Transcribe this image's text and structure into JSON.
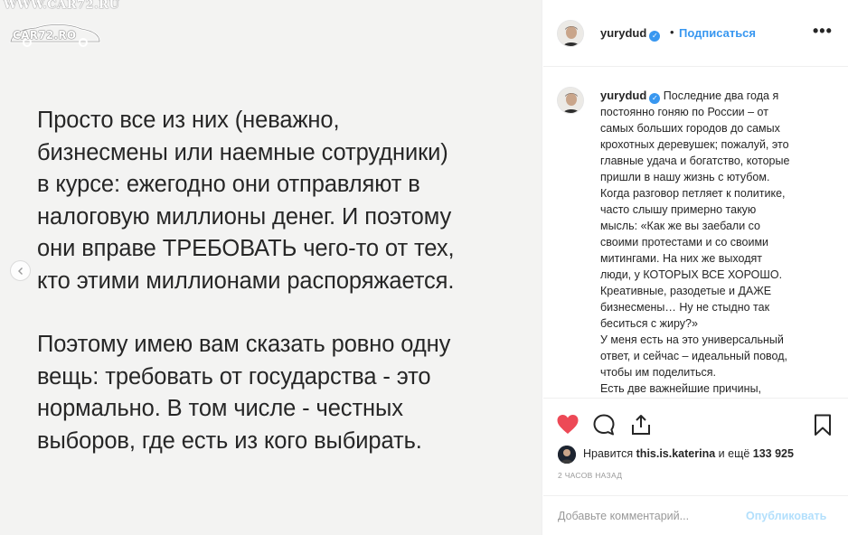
{
  "watermark": {
    "site_top": "WWW.CAR72.RU",
    "logo_text": "CAR72.RO"
  },
  "image_text": {
    "paragraph1": [
      "Просто все из них (неважно,",
      "бизнесмены или наемные сотрудники)",
      "в курсе: ежегодно они отправляют в",
      "налоговую миллионы денег. И поэтому",
      "они вправе ТРЕБОВАТЬ чего-то от тех,",
      "кто этими миллионами распоряжается."
    ],
    "paragraph2": [
      "Поэтому имею вам сказать ровно одну",
      "вещь: требовать от государства - это",
      "нормально. В том числе - честных",
      "выборов, где есть из кого выбирать."
    ]
  },
  "header": {
    "username": "yurydud",
    "separator": "•",
    "follow_label": "Подписаться",
    "more_icon": "more-options-icon",
    "more_glyph": "•••"
  },
  "caption": {
    "username": "yurydud",
    "lines": [
      "Последние два года я",
      "постоянно гоняю по России – от",
      "самых больших городов до самых",
      "крохотных деревушек; пожалуй, это",
      "главные удача и богатство, которые",
      "пришли в нашу жизнь с ютубом.",
      "Когда разговор петляет к политике,",
      "часто слышу примерно такую",
      "мысль: «Как же вы заебали со",
      "своими протестами и со своими",
      "митингами. На них же выходят",
      "люди, у КОТОРЫХ ВСЕ ХОРОШО.",
      "Креативные, разодетые и ДАЖЕ",
      "бизнесмены… Ну не стыдно так",
      "беситься с жиру?»",
      "У меня есть на это универсальный",
      "ответ, и сейчас – идеальный повод,",
      "чтобы им поделиться.",
      "Есть две важнейшие причины,"
    ]
  },
  "actions": {
    "like_icon": "heart-icon",
    "comment_icon": "comment-icon",
    "share_icon": "share-icon",
    "save_icon": "bookmark-icon",
    "like_color": "#ed4956"
  },
  "likes": {
    "prefix": "Нравится ",
    "user": "this.is.katerina",
    "suffix": " и ещё ",
    "count": "133 925"
  },
  "timestamp": "2 ЧАСОВ НАЗАД",
  "comment": {
    "placeholder": "Добавьте комментарий...",
    "post_label": "Опубликовать"
  },
  "colors": {
    "link": "#3897f0",
    "post_disabled": "#b2dffc",
    "image_bg": "#f3f3f2"
  }
}
